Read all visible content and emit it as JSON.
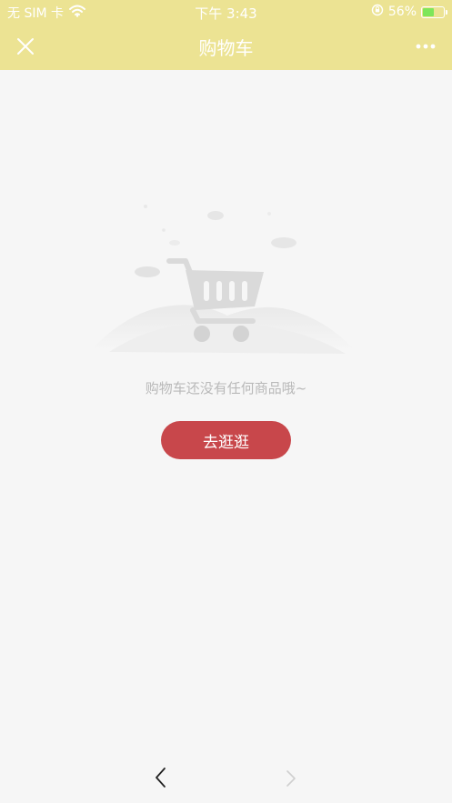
{
  "status_bar": {
    "carrier": "无 SIM 卡",
    "time": "下午 3:43",
    "battery_percent": "56%",
    "battery_level": 0.56,
    "icons": [
      "wifi-icon",
      "orientation-lock-icon",
      "battery-charging-icon"
    ]
  },
  "navbar": {
    "title": "购物车",
    "close_icon": "close-icon",
    "more_icon": "more-dots-icon"
  },
  "empty_state": {
    "illustration": "empty-cart-illustration",
    "message": "购物车还没有任何商品哦~",
    "button_label": "去逛逛"
  },
  "bottom_nav": {
    "back_icon": "chevron-left-icon",
    "forward_icon": "chevron-right-icon"
  },
  "colors": {
    "header_bg": "#ece393",
    "page_bg": "#f6f6f6",
    "button_bg": "#c8474b",
    "message_text": "#b9b9b9",
    "battery_fill": "#7ee65a"
  }
}
